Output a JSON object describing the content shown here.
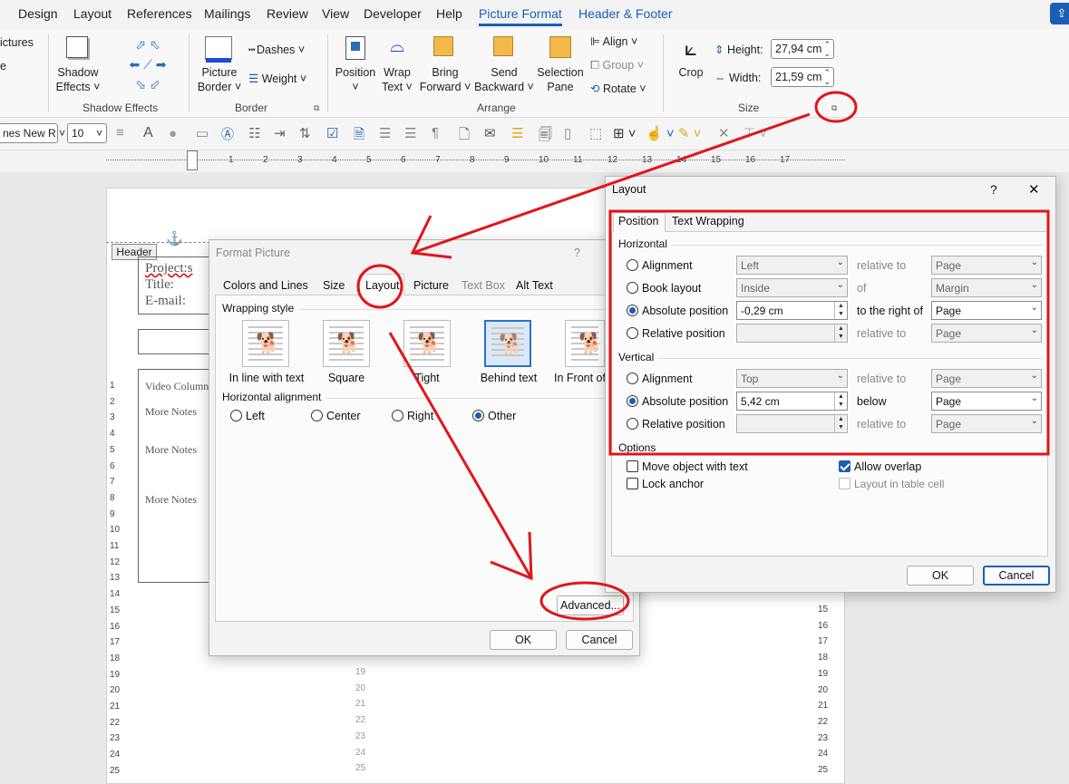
{
  "tabs": [
    "Design",
    "Layout",
    "References",
    "Mailings",
    "Review",
    "View",
    "Developer",
    "Help",
    "Picture Format",
    "Header & Footer"
  ],
  "ribbon": {
    "partial_pictures": "ictures",
    "partial_e": "e",
    "shadow_effects_btn": "Shadow",
    "shadow_effects_btn2": "Effects",
    "shadow_group": "Shadow Effects",
    "picture_border_1": "Picture",
    "picture_border_2": "Border",
    "dashes": "Dashes",
    "weight": "Weight",
    "border_group": "Border",
    "position": "Position",
    "wrap_text_1": "Wrap",
    "wrap_text_2": "Text",
    "bring_forward_1": "Bring",
    "bring_forward_2": "Forward",
    "send_backward_1": "Send",
    "send_backward_2": "Backward",
    "selection_pane_1": "Selection",
    "selection_pane_2": "Pane",
    "align": "Align",
    "group": "Group",
    "rotate": "Rotate",
    "arrange_group": "Arrange",
    "crop": "Crop",
    "height_label": "Height:",
    "height_value": "27,94 cm",
    "width_label": "Width:",
    "width_value": "21,59 cm",
    "size_group": "Size"
  },
  "qat": {
    "font": "nes New R",
    "size": "10"
  },
  "ruler_numbers": [
    "1",
    "2",
    "3",
    "4",
    "5",
    "6",
    "7",
    "8",
    "9",
    "10",
    "11",
    "12",
    "13",
    "14",
    "15",
    "16",
    "17"
  ],
  "document": {
    "header_tag": "Header",
    "project": "Project:s",
    "title": "Title:",
    "email": "E-mail:",
    "video_column": "Video Column",
    "more_notes_1": "More Notes",
    "more_notes_2": "More Notes",
    "more_notes_3": "More Notes",
    "line_numbers": [
      "1",
      "2",
      "3",
      "4",
      "5",
      "6",
      "7",
      "8",
      "9",
      "10",
      "11",
      "12",
      "13",
      "14",
      "15",
      "16",
      "17",
      "18",
      "19",
      "20",
      "21",
      "22",
      "23",
      "24",
      "25"
    ],
    "right_numbers": [
      "15",
      "16",
      "17",
      "18",
      "19",
      "20",
      "21",
      "22",
      "23",
      "24",
      "25"
    ],
    "mid_numbers": [
      "19",
      "20",
      "21",
      "22",
      "23",
      "24",
      "25"
    ]
  },
  "format_picture": {
    "title": "Format Picture",
    "help": "?",
    "tabs": [
      "Colors and Lines",
      "Size",
      "Layout",
      "Picture",
      "Text Box",
      "Alt Text"
    ],
    "wrapping_style": "Wrapping style",
    "wrap_options": [
      "In line with text",
      "Square",
      "Tight",
      "Behind text",
      "In Front of"
    ],
    "horizontal_alignment": "Horizontal alignment",
    "align_options": [
      "Left",
      "Center",
      "Right",
      "Other"
    ],
    "advanced": "Advanced...",
    "ok": "OK",
    "cancel": "Cancel"
  },
  "layout_dialog": {
    "title": "Layout",
    "help": "?",
    "close": "✕",
    "tabs": [
      "Position",
      "Text Wrapping"
    ],
    "horizontal": "Horizontal",
    "h_rows": [
      {
        "label": "Alignment",
        "value": "Left",
        "rel": "relative to",
        "target": "Page"
      },
      {
        "label": "Book layout",
        "value": "Inside",
        "rel": "of",
        "target": "Margin"
      },
      {
        "label": "Absolute position",
        "value": "-0,29 cm",
        "rel": "to the right of",
        "target": "Page"
      },
      {
        "label": "Relative position",
        "value": "",
        "rel": "relative to",
        "target": "Page"
      }
    ],
    "vertical": "Vertical",
    "v_rows": [
      {
        "label": "Alignment",
        "value": "Top",
        "rel": "relative to",
        "target": "Page"
      },
      {
        "label": "Absolute position",
        "value": "5,42 cm",
        "rel": "below",
        "target": "Page"
      },
      {
        "label": "Relative position",
        "value": "",
        "rel": "relative to",
        "target": "Page"
      }
    ],
    "options": "Options",
    "move_object": "Move object with text",
    "lock_anchor": "Lock anchor",
    "allow_overlap": "Allow overlap",
    "layout_in_table": "Layout in table cell",
    "ok": "OK",
    "cancel": "Cancel"
  },
  "colors": {
    "accent": "#1a5fb4",
    "annotation": "#e0161b"
  }
}
